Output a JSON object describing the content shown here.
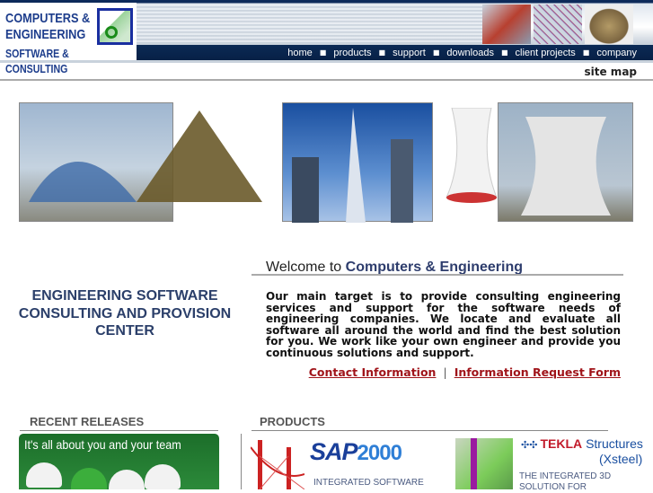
{
  "logo": {
    "line1": "COMPUTERS &",
    "line2": "ENGINEERING",
    "line3": "SOFTWARE & CONSULTING"
  },
  "nav": [
    {
      "label": "home"
    },
    {
      "label": "products"
    },
    {
      "label": "support"
    },
    {
      "label": "downloads"
    },
    {
      "label": "client projects"
    },
    {
      "label": "company"
    }
  ],
  "site_map": "site map",
  "tagline": "ENGINEERING SOFTWARE CONSULTING AND PROVISION CENTER",
  "welcome": {
    "prefix": "Welcome to",
    "name": "Computers & Engineering",
    "paragraph": "Our main target is to provide consulting engineering services and support for the software needs of engineering companies. We locate and evaluate all software all around the world and find the best solution for you. We work like your own engineer and provide you continuous solutions and support.",
    "contact_link": "Contact Information",
    "separator": "|",
    "request_link": "Information Request Form"
  },
  "sections": {
    "recent": "RECENT RELEASES",
    "products": "PRODUCTS"
  },
  "banner": "It's all about you and your team",
  "products": [
    {
      "logo_main": "SAP",
      "logo_num": "2000",
      "desc": "INTEGRATED SOFTWARE"
    },
    {
      "logo_brand": "TEKLA",
      "logo_product": "Structures",
      "logo_sub": "(Xsteel)",
      "desc": "THE INTEGRATED 3D SOLUTION FOR"
    }
  ]
}
